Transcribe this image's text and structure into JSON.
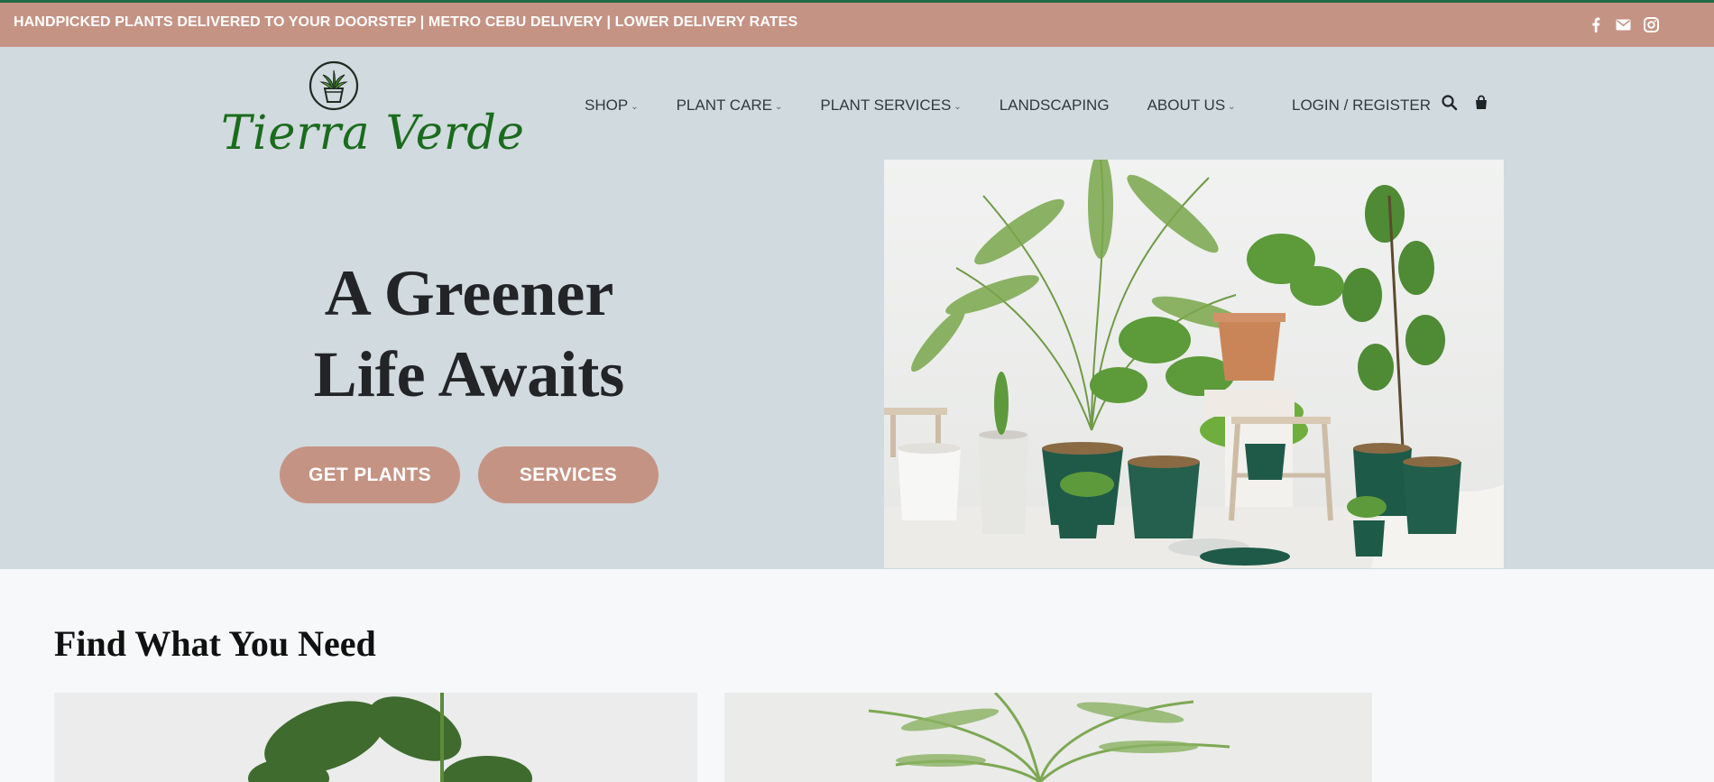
{
  "topbar": {
    "announcement": "HANDPICKED PLANTS DELIVERED TO YOUR DOORSTEP | METRO CEBU DELIVERY | LOWER DELIVERY RATES",
    "social_icons": [
      "facebook-icon",
      "email-icon",
      "instagram-icon"
    ]
  },
  "brand": {
    "name": "Tierra Verde"
  },
  "nav": {
    "items": [
      {
        "label": "SHOP",
        "dropdown": true
      },
      {
        "label": "PLANT CARE",
        "dropdown": true
      },
      {
        "label": "PLANT SERVICES",
        "dropdown": true
      },
      {
        "label": "LANDSCAPING",
        "dropdown": false
      },
      {
        "label": "ABOUT US",
        "dropdown": true
      }
    ],
    "login_label": "LOGIN / REGISTER",
    "icons": [
      "search-icon",
      "shopping-bag-icon"
    ]
  },
  "hero": {
    "headline_line1": "A Greener",
    "headline_line2": "Life Awaits",
    "primary_button": "GET PLANTS",
    "secondary_button": "SERVICES"
  },
  "section": {
    "title": "Find What You Need"
  },
  "colors": {
    "accent": "#c59384",
    "brand_green": "#1a6b1d",
    "hero_bg": "#d1dade",
    "top_border": "#1d6b47"
  }
}
